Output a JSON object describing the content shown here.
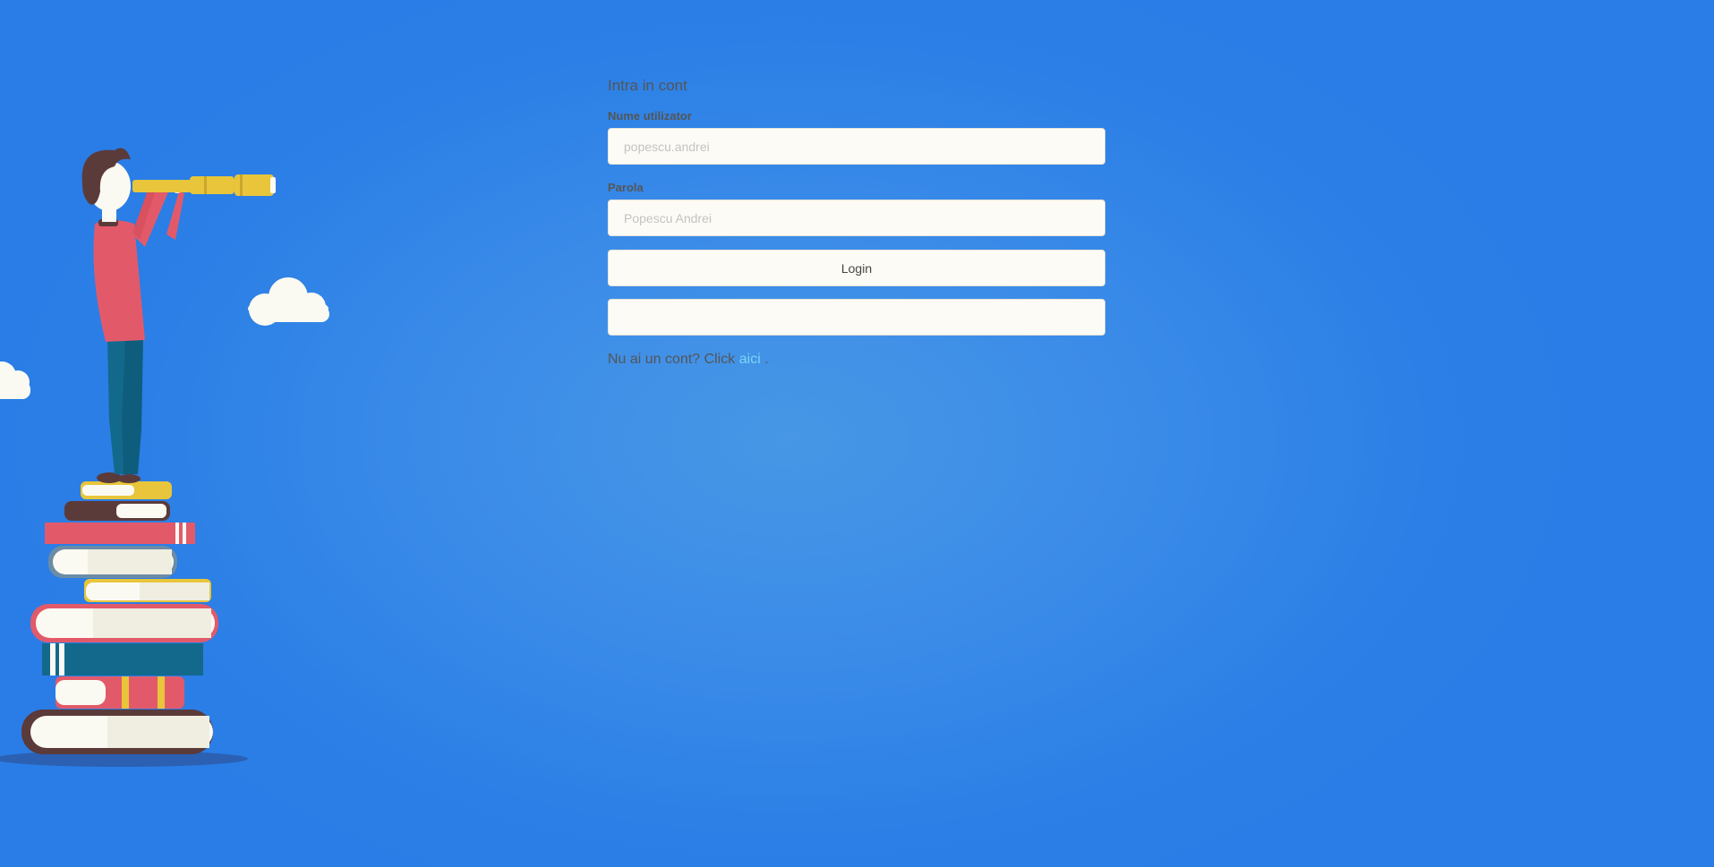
{
  "login": {
    "title": "Intra in cont",
    "username": {
      "label": "Nume utilizator",
      "placeholder": "popescu.andrei"
    },
    "password": {
      "label": "Parola",
      "placeholder": "Popescu Andrei"
    },
    "login_button": "Login",
    "secondary_button": "",
    "register": {
      "text_before": "Nu ai un cont? Click",
      "link_text": "aici",
      "text_after": "."
    }
  },
  "colors": {
    "background": "#3a8be8",
    "input_background": "#fdfbf5",
    "link": "#7fd3f4",
    "text": "#555555"
  },
  "illustration": "man-with-telescope-on-books-illustration"
}
